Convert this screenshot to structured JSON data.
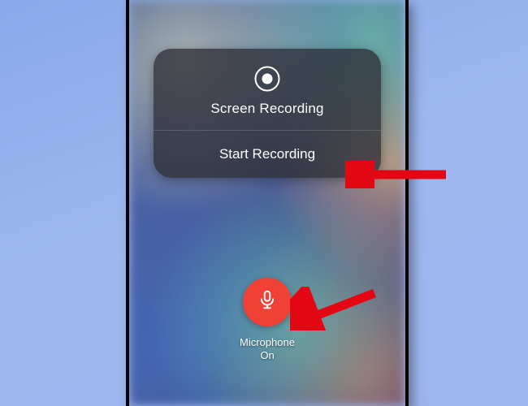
{
  "panel": {
    "title": "Screen Recording",
    "action": "Start Recording"
  },
  "microphone": {
    "label": "Microphone",
    "status": "On"
  },
  "colors": {
    "accent_red": "#ef4135"
  },
  "icons": {
    "record": "record-icon",
    "microphone": "microphone-icon"
  }
}
